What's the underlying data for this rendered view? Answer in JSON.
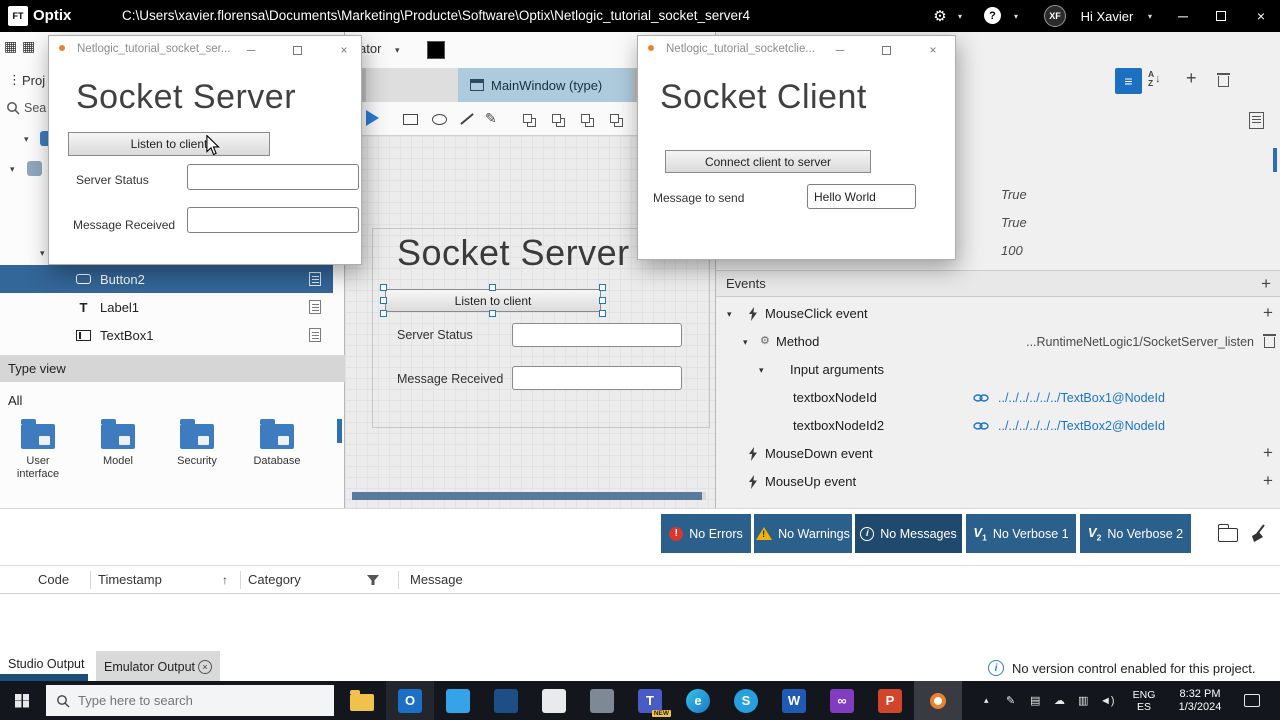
{
  "colors": {
    "accent_blue": "#1d6fc0",
    "tree_selection_blue": "#336699",
    "optix_orange": "#e8822d",
    "status_button_blue": "#2b5f8c",
    "status_button_dark_blue": "#20496e",
    "error_red": "#d6392c",
    "warning_yellow": "#f0b400",
    "link_blue": "#1a73c9",
    "active_tab_blue": "#aecadd"
  },
  "glyphs": {
    "grid": "▦",
    "dots": "⋮",
    "chevron": "▾",
    "minimize": "─",
    "close": "×",
    "plus": "+",
    "gear": "⚙",
    "help": "?",
    "pen": "✎",
    "up_arrow": "↑",
    "sort_a": "A",
    "sort_z": "Z",
    "sort_arrow": "↓",
    "chevron_up": "▴",
    "tray_pen": "✎",
    "tray_device": "▤",
    "tray_cloud": "☁",
    "tray_display": "▥",
    "tray_volume": "◄)",
    "list": "≡"
  },
  "titlebar": {
    "logo_text": "FT",
    "app_name": "Optix",
    "path": "C:\\Users\\xavier.florensa\\Documents\\Marketing\\Producte\\Software\\Optix\\Netlogic_tutorial_socket_server4",
    "user_initials": "XF",
    "greeting": "Hi Xavier"
  },
  "server_window": {
    "title": "Netlogic_tutorial_socket_ser...",
    "heading": "Socket Server",
    "button_label": "Listen to client",
    "field1_label": "Server Status",
    "field1_value": "",
    "field2_label": "Message Received",
    "field2_value": ""
  },
  "client_window": {
    "title": "Netlogic_tutorial_socketclie...",
    "heading": "Socket Client",
    "button_label": "Connect client to server",
    "field_label": "Message to send",
    "field_value": "Hello World"
  },
  "left_panel": {
    "project_header": "Proj",
    "search_text": "Sea",
    "tree": [
      {
        "label": "Button2"
      },
      {
        "label": "Label1"
      },
      {
        "label": "TextBox1"
      }
    ],
    "type_view_header": "Type view",
    "all_label": "All",
    "categories": [
      {
        "label": "User interface"
      },
      {
        "label": "Model"
      },
      {
        "label": "Security"
      },
      {
        "label": "Database"
      }
    ]
  },
  "canvas": {
    "toolbar_fragment": "ator",
    "tab_label": "MainWindow (type)",
    "heading": "Socket Server",
    "button_label": "Listen to client",
    "field1_label": "Server Status",
    "field2_label": "Message Received"
  },
  "right_panel": {
    "prop_values": [
      "True",
      "True",
      "100"
    ],
    "events_title": "Events",
    "mouseclick_label": "MouseClick event",
    "method_label": "Method",
    "method_value": "...RuntimeNetLogic1/SocketServer_listen",
    "input_args_label": "Input arguments",
    "arg1_name": "textboxNodeId",
    "arg1_value": "../../../../../../TextBox1@NodeId",
    "arg2_name": "textboxNodeId2",
    "arg2_value": "../../../../../../TextBox2@NodeId",
    "mousedown_label": "MouseDown event",
    "mouseup_label": "MouseUp event"
  },
  "status_bar": {
    "buttons": [
      {
        "label": "No Errors"
      },
      {
        "label": "No Warnings"
      },
      {
        "label": "No Messages"
      },
      {
        "label": "No Verbose 1",
        "icon_v": "V",
        "icon_n": "1"
      },
      {
        "label": "No Verbose 2",
        "icon_v": "V",
        "icon_n": "2"
      }
    ]
  },
  "output": {
    "col_code": "Code",
    "col_timestamp": "Timestamp",
    "col_category": "Category",
    "col_message": "Message",
    "tab1": "Studio Output",
    "tab2": "Emulator Output",
    "notice": "No version control enabled for this project."
  },
  "taskbar": {
    "search_placeholder": "Type here to search",
    "lang1": "ENG",
    "lang2": "ES",
    "time": "8:32 PM",
    "date": "1/3/2024",
    "teams_badge": "NEW",
    "icons": [
      {
        "name": "file-explorer",
        "glyph": ""
      },
      {
        "name": "outlook",
        "glyph": "O"
      },
      {
        "name": "app-3",
        "glyph": ""
      },
      {
        "name": "app-4",
        "glyph": ""
      },
      {
        "name": "app-5",
        "glyph": ""
      },
      {
        "name": "app-6",
        "glyph": ""
      },
      {
        "name": "teams",
        "glyph": "T"
      },
      {
        "name": "edge",
        "glyph": "e"
      },
      {
        "name": "skype",
        "glyph": "S"
      },
      {
        "name": "word",
        "glyph": "W"
      },
      {
        "name": "visual-studio",
        "glyph": "∞"
      },
      {
        "name": "powerpoint",
        "glyph": "P"
      },
      {
        "name": "optix",
        "glyph": ""
      }
    ]
  }
}
